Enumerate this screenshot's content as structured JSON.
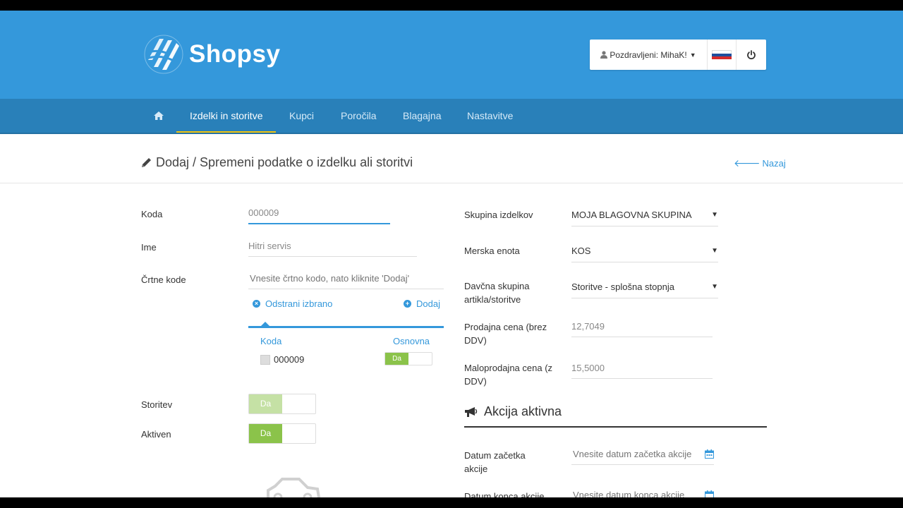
{
  "app": {
    "name": "Shopsy"
  },
  "header": {
    "greeting": "Pozdravljeni: MihaK!",
    "flag_colors": [
      "#ffffff",
      "#1f4e9c",
      "#d62b2b"
    ]
  },
  "nav": {
    "items": [
      {
        "label": "Izdelki in storitve",
        "active": true
      },
      {
        "label": "Kupci"
      },
      {
        "label": "Poročila"
      },
      {
        "label": "Blagajna"
      },
      {
        "label": "Nastavitve"
      }
    ]
  },
  "page": {
    "title": "Dodaj / Spremeni podatke o izdelku ali storitvi",
    "back_label": "Nazaj"
  },
  "form_left": {
    "code_label": "Koda",
    "code_value": "000009",
    "name_label": "Ime",
    "name_value": "Hitri servis",
    "barcodes_label": "Črtne kode",
    "barcode_placeholder": "Vnesite črtno kodo, nato kliknite 'Dodaj'",
    "remove_selected": "Odstrani izbrano",
    "add": "Dodaj",
    "table_headers": [
      "Koda",
      "Osnovna"
    ],
    "barcode_rows": [
      {
        "code": "000009",
        "primary": "Da"
      }
    ],
    "service_label": "Storitev",
    "service_toggle": "Da",
    "active_label": "Aktiven",
    "active_toggle": "Da"
  },
  "form_right": {
    "group_label": "Skupina izdelkov",
    "group_value": "MOJA BLAGOVNA SKUPINA",
    "unit_label": "Merska enota",
    "unit_value": "KOS",
    "tax_label": "Davčna skupina artikla/storitve",
    "tax_value": "Storitve - splošna stopnja",
    "price_net_label": "Prodajna cena (brez DDV)",
    "price_net_value": "12,7049",
    "price_gross_label": "Maloprodajna cena (z DDV)",
    "price_gross_value": "15,5000",
    "promo_title": "Akcija aktivna",
    "start_label": "Datum začetka akcije",
    "start_placeholder": "Vnesite datum začetka akcije",
    "end_label": "Datum konca akcije",
    "end_placeholder": "Vnesite datum konca akcije"
  },
  "colors": {
    "header": "#3498db",
    "navbar": "#2980b9",
    "accent": "#3498db",
    "toggle_on": "#8bc34a",
    "nav_active_underline": "#f1c40f"
  }
}
